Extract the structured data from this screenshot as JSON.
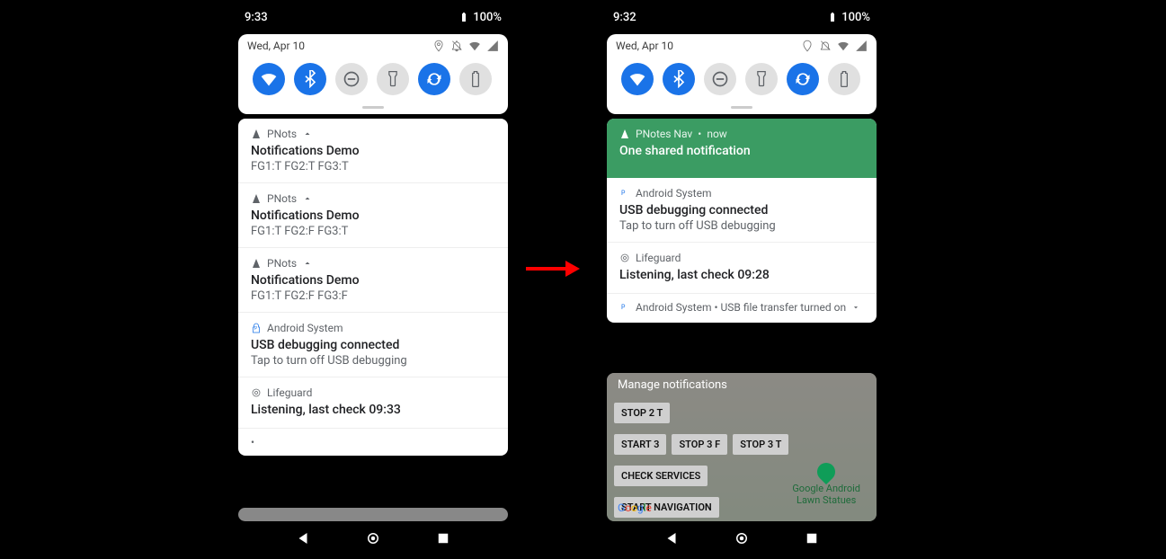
{
  "left": {
    "status": {
      "time": "9:33",
      "battery": "100%"
    },
    "date": "Wed, Apr 10",
    "qs": {
      "wifi": true,
      "bt": true,
      "dnd": false,
      "torch": false,
      "rotate": true,
      "saver": false
    },
    "notifs": [
      {
        "app": "PNots",
        "title": "Notifications Demo",
        "body": "FG1:T FG2:T FG3:T",
        "collapse": true
      },
      {
        "app": "PNots",
        "title": "Notifications Demo",
        "body": "FG1:T FG2:F FG3:T",
        "collapse": true
      },
      {
        "app": "PNots",
        "title": "Notifications Demo",
        "body": "FG1:T FG2:F FG3:F",
        "collapse": true
      },
      {
        "app": "Android System",
        "title": "USB debugging connected",
        "body": "Tap to turn off USB debugging"
      },
      {
        "app": "Lifeguard",
        "title": "Listening, last check 09:33",
        "body": ""
      }
    ]
  },
  "right": {
    "status": {
      "time": "9:32",
      "battery": "100%"
    },
    "date": "Wed, Apr 10",
    "qs": {
      "wifi": true,
      "bt": true,
      "dnd": false,
      "torch": false,
      "rotate": true,
      "saver": false
    },
    "green": {
      "app": "PNotes Nav",
      "when": "now",
      "title": "One shared notification"
    },
    "notifs": [
      {
        "app": "Android System",
        "title": "USB debugging connected",
        "body": "Tap to turn off USB debugging"
      },
      {
        "app": "Lifeguard",
        "title": "Listening, last check 09:28",
        "body": ""
      }
    ],
    "collapsed": "Android System • USB file transfer turned on",
    "manage": "Manage notifications",
    "buttons_row1": [
      "STOP 2 T"
    ],
    "buttons_row2": [
      "START 3",
      "STOP 3 F",
      "STOP 3 T"
    ],
    "buttons_row3": [
      "CHECK SERVICES"
    ],
    "buttons_row4": [
      "START NAVIGATION"
    ],
    "place": "Google Android\nLawn Statues",
    "glogo": "Google"
  }
}
